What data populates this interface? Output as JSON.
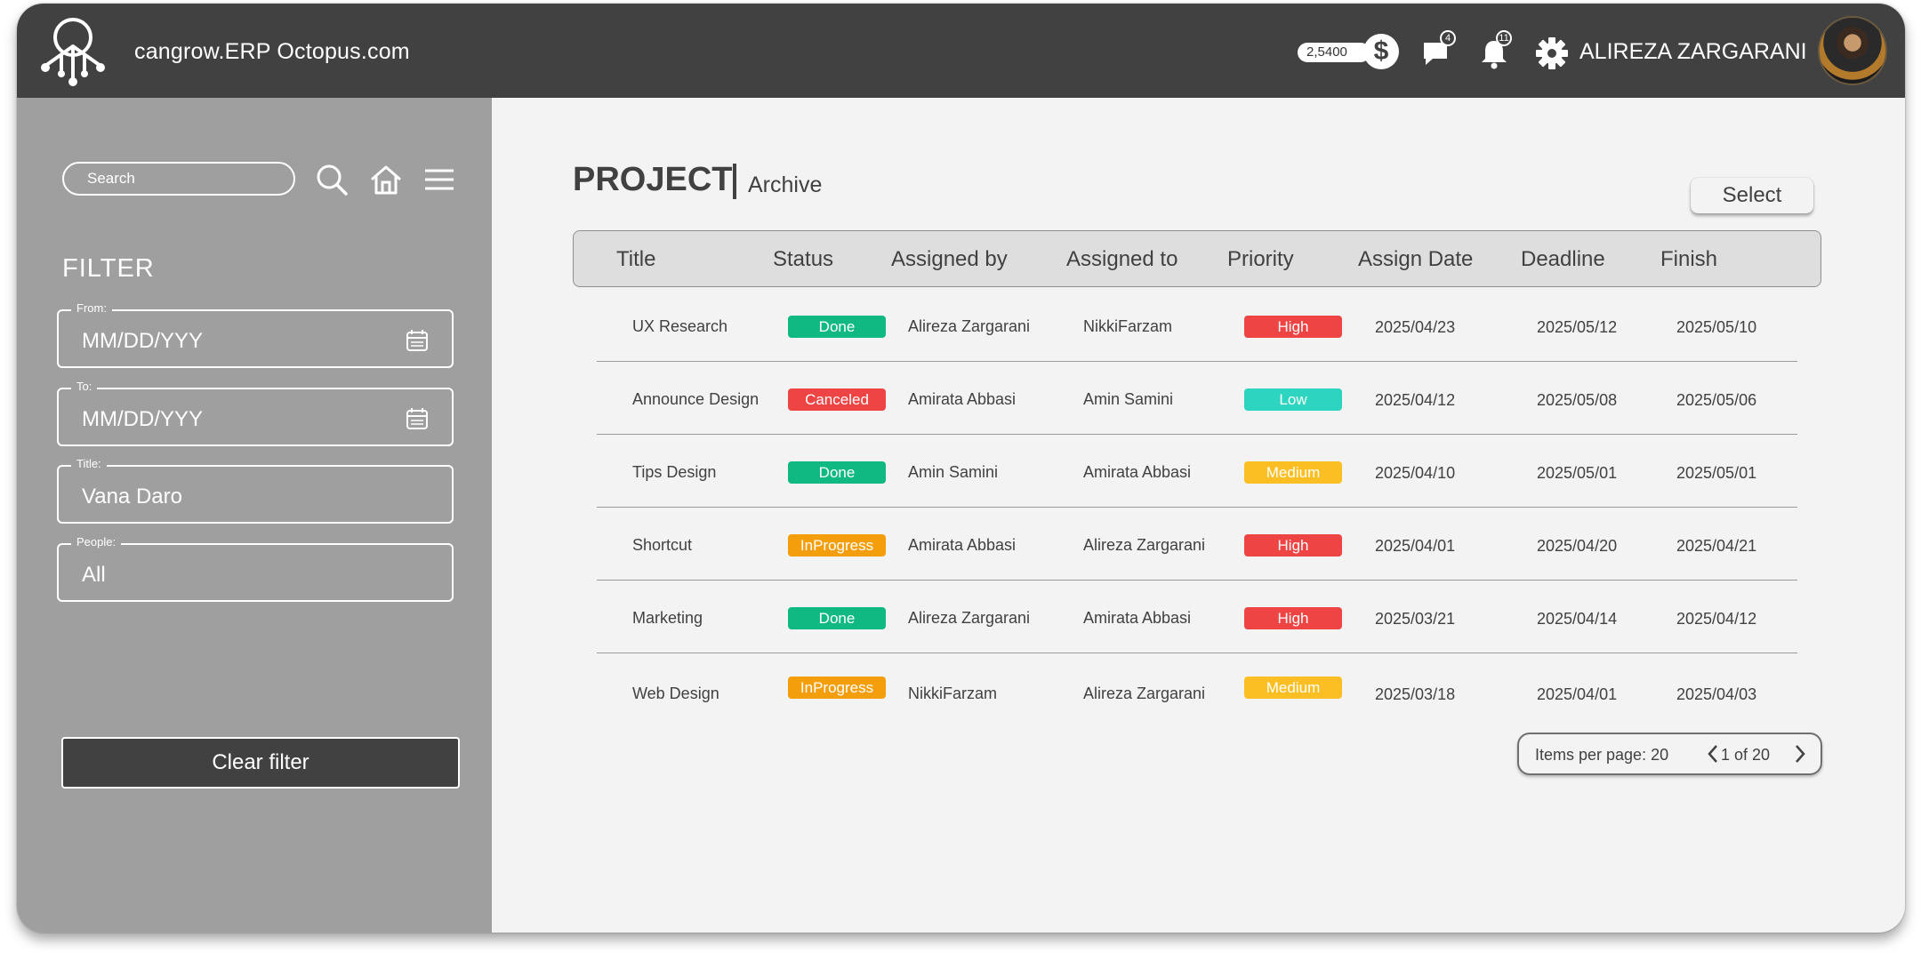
{
  "header": {
    "app_title": "cangrow.ERP Octopus.com",
    "coins": "2,5400",
    "coin_symbol": "$",
    "messages_count": "4",
    "notifications_count": "11",
    "user_name": "ALIREZA ZARGARANI"
  },
  "sidebar": {
    "search_placeholder": "Search",
    "filter_title": "FILTER",
    "fields": [
      {
        "label": "From:",
        "value": "MM/DD/YYY"
      },
      {
        "label": "To:",
        "value": "MM/DD/YYY"
      },
      {
        "label": "Title:",
        "value": "Vana Daro"
      },
      {
        "label": "People:",
        "value": "All"
      }
    ],
    "clear_label": "Clear filter"
  },
  "main": {
    "title": "PROJECT",
    "subtitle": "Archive",
    "select_label": "Select",
    "columns": [
      "Title",
      "Status",
      "Assigned by",
      "Assigned to",
      "Priority",
      "Assign Date",
      "Deadline",
      "Finish"
    ],
    "rows": [
      {
        "title": "UX Research",
        "status": "Done",
        "by": "Alireza Zargarani",
        "to": "NikkiFarzam",
        "priority": "High",
        "assign": "2025/04/23",
        "deadline": "2025/05/12",
        "finish": "2025/05/10"
      },
      {
        "title": "Announce Design",
        "status": "Canceled",
        "by": "Amirata Abbasi",
        "to": "Amin Samini",
        "priority": "Low",
        "assign": "2025/04/12",
        "deadline": "2025/05/08",
        "finish": "2025/05/06"
      },
      {
        "title": "Tips Design",
        "status": "Done",
        "by": "Amin Samini",
        "to": "Amirata Abbasi",
        "priority": "Medium",
        "assign": "2025/04/10",
        "deadline": "2025/05/01",
        "finish": "2025/05/01"
      },
      {
        "title": "Shortcut",
        "status": "InProgress",
        "by": "Amirata Abbasi",
        "to": "Alireza Zargarani",
        "priority": "High",
        "assign": "2025/04/01",
        "deadline": "2025/04/20",
        "finish": "2025/04/21"
      },
      {
        "title": "Marketing",
        "status": "Done",
        "by": "Alireza Zargarani",
        "to": "Amirata Abbasi",
        "priority": "High",
        "assign": "2025/03/21",
        "deadline": "2025/04/14",
        "finish": "2025/04/12"
      },
      {
        "title": "Web Design",
        "status": "InProgress",
        "by": "NikkiFarzam",
        "to": "Alireza Zargarani",
        "priority": "Medium",
        "assign": "2025/03/18",
        "deadline": "2025/04/01",
        "finish": "2025/04/03"
      }
    ],
    "pager": {
      "items_label": "Items per page: 20",
      "page_label": "1 of 20"
    }
  },
  "colors": {
    "header_bg": "#414141",
    "sidebar_bg": "#9f9f9f",
    "status": {
      "Done": "#10b981",
      "Canceled": "#ef4444",
      "InProgress": "#f59e0b"
    },
    "priority": {
      "High": "#ef4444",
      "Low": "#2dd4bf",
      "Medium": "#fbbf24"
    }
  },
  "icons": [
    "logo-icon",
    "dollar-icon",
    "chat-icon",
    "bell-icon",
    "gear-icon",
    "search-icon",
    "home-icon",
    "menu-icon",
    "calendar-icon",
    "chevron-left-icon",
    "chevron-right-icon"
  ]
}
